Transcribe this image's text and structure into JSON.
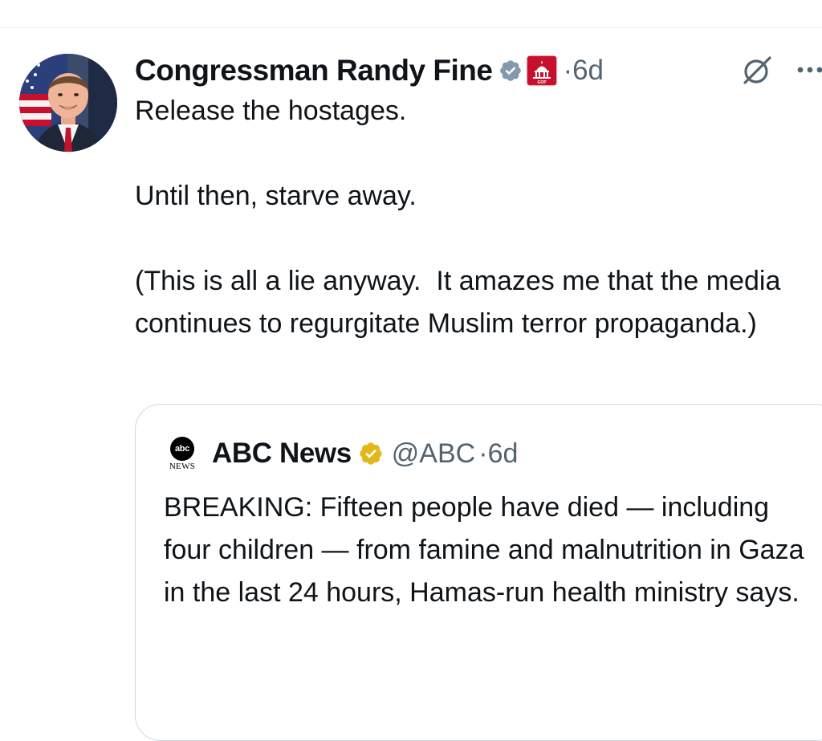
{
  "tweet": {
    "author_name": "Congressman Randy Fine",
    "separator": "·",
    "timestamp": "6d",
    "text": "Release the hostages.\n\nUntil then, starve away.\n\n(This is all a lie anyway.  It amazes me that the media continues to regurgitate Muslim terror propaganda.)"
  },
  "quote": {
    "logo_abbr": "abc",
    "logo_sub": "NEWS",
    "author_name": "ABC News",
    "handle": "@ABC",
    "separator": "·",
    "timestamp": "6d",
    "text": "BREAKING: Fifteen people have died — including four children — from famine and malnutrition in Gaza in the last 24 hours, Hamas-run health ministry says."
  },
  "icons": {
    "verified": "verified-badge-icon",
    "affiliation": "house-gop-affiliation-icon",
    "grok": "grok-icon",
    "more": "more-options-icon",
    "gold_verified": "gold-verified-badge-icon"
  },
  "colors": {
    "verified_badge": "#829aab",
    "gold_badge": "#e2b719",
    "affiliation_red": "#c8102e",
    "secondary_text": "#536471",
    "border": "#cfd9de"
  }
}
